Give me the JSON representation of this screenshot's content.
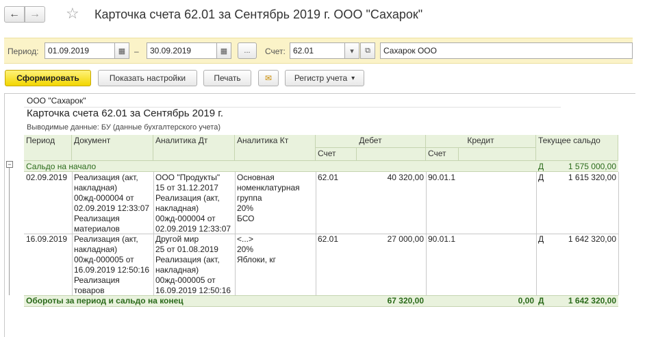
{
  "window": {
    "title": "Карточка счета 62.01 за Сентябрь 2019 г. ООО \"Сахарок\"",
    "back_glyph": "←",
    "forward_glyph": "→",
    "star_glyph": "☆"
  },
  "params": {
    "period_label": "Период:",
    "date_from": "01.09.2019",
    "dash": "–",
    "date_to": "30.09.2019",
    "ellipsis": "...",
    "account_label": "Счет:",
    "account": "62.01",
    "organization": "Сахарок ООО"
  },
  "toolbar": {
    "generate": "Сформировать",
    "show_settings": "Показать настройки",
    "print": "Печать",
    "register": "Регистр учета"
  },
  "report": {
    "org": "ООО \"Сахарок\"",
    "title": "Карточка счета 62.01 за Сентябрь 2019 г.",
    "subtitle": "Выводимые данные:  БУ (данные бухгалтерского учета)",
    "headers": {
      "period": "Период",
      "document": "Документ",
      "analytics_dt": "Аналитика Дт",
      "analytics_kt": "Аналитика Кт",
      "debit": "Дебет",
      "credit": "Кредит",
      "balance": "Текущее сальдо",
      "debit_account": "Счет",
      "credit_account": "Счет"
    },
    "opening": {
      "label": "Сальдо на начало",
      "side": "Д",
      "amount": "1 575 000,00"
    },
    "rows": [
      {
        "period": "02.09.2019",
        "document": [
          "Реализация (акт,",
          "накладная)",
          "00жд-000004 от",
          "02.09.2019 12:33:07",
          "Реализация",
          "материалов"
        ],
        "analytics_dt": [
          "ООО \"Продукты\"",
          "15 от 31.12.2017",
          "Реализация (акт,",
          "накладная)",
          "00жд-000004 от",
          "02.09.2019 12:33:07"
        ],
        "analytics_kt": [
          "Основная",
          "номенклатурная",
          "группа",
          "20%",
          "БСО"
        ],
        "debit_account": "62.01",
        "debit_amount": "40 320,00",
        "credit_account": "90.01.1",
        "credit_amount": "",
        "side": "Д",
        "balance": "1 615 320,00"
      },
      {
        "period": "16.09.2019",
        "document": [
          "Реализация (акт,",
          "накладная)",
          "00жд-000005 от",
          "16.09.2019 12:50:16",
          "Реализация",
          "товаров"
        ],
        "analytics_dt": [
          "Другой мир",
          "25 от 01.08.2019",
          "Реализация (акт,",
          "накладная)",
          "00жд-000005 от",
          "16.09.2019 12:50:16"
        ],
        "analytics_kt": [
          "<...>",
          "20%",
          "Яблоки, кг"
        ],
        "debit_account": "62.01",
        "debit_amount": "27 000,00",
        "credit_account": "90.01.1",
        "credit_amount": "",
        "side": "Д",
        "balance": "1 642 320,00"
      }
    ],
    "totals": {
      "label": "Обороты за период и сальдо на конец",
      "debit": "67 320,00",
      "credit": "0,00",
      "side": "Д",
      "balance": "1 642 320,00"
    }
  }
}
